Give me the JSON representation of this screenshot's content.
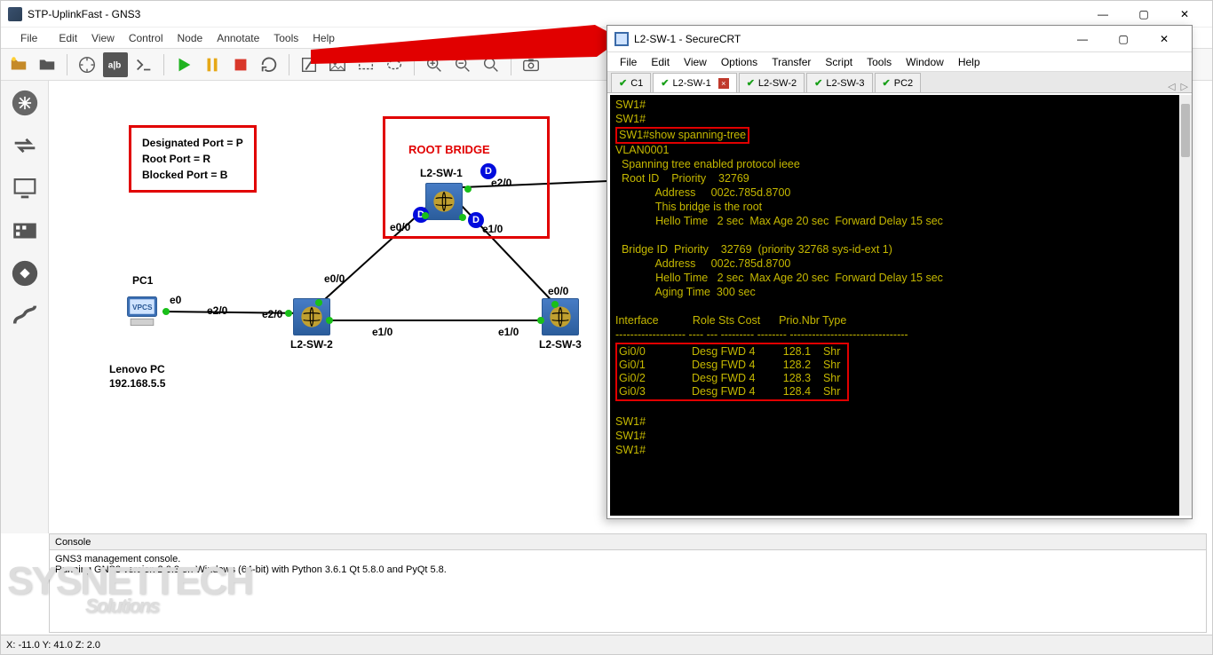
{
  "gns3": {
    "title": "STP-UplinkFast - GNS3",
    "menu": [
      "File",
      "Edit",
      "View",
      "Control",
      "Node",
      "Annotate",
      "Tools",
      "Help"
    ],
    "statusbar": "X: -11.0 Y: 41.0 Z: 2.0",
    "legend": {
      "line1": "Designated Port  = P",
      "line2": "Root Port            = R",
      "line3": "Blocked Port       = B"
    },
    "root_bridge_label": "ROOT BRIDGE",
    "nodes": {
      "sw1": "L2-SW-1",
      "sw2": "L2-SW-2",
      "sw3": "L2-SW-3",
      "pc1": "PC1",
      "pc1_sub1": "Lenovo PC",
      "pc1_sub2": "192.168.5.5",
      "vpcs": "VPCS"
    },
    "ports": {
      "e0": "e0",
      "e20": "e2/0",
      "e00": "e0/0",
      "e10": "e1/0"
    },
    "badge": "D",
    "console_title": "Console",
    "console_lines": [
      "GNS3 management console.",
      "Running GNS3 version 2.0.3 on Windows (64-bit) with Python 3.6.1 Qt 5.8.0 and PyQt 5.8."
    ]
  },
  "securecrt": {
    "title": "L2-SW-1 - SecureCRT",
    "menu": [
      "File",
      "Edit",
      "View",
      "Options",
      "Transfer",
      "Script",
      "Tools",
      "Window",
      "Help"
    ],
    "tabs": [
      {
        "label": "C1",
        "active": false,
        "closable": false
      },
      {
        "label": "L2-SW-1",
        "active": true,
        "closable": true
      },
      {
        "label": "L2-SW-2",
        "active": false,
        "closable": false
      },
      {
        "label": "L2-SW-3",
        "active": false,
        "closable": false
      },
      {
        "label": "PC2",
        "active": false,
        "closable": false
      }
    ],
    "term": {
      "prompts": [
        "SW1#",
        "SW1#"
      ],
      "cmd": "SW1#show spanning-tree",
      "body": "\nVLAN0001\n  Spanning tree enabled protocol ieee\n  Root ID    Priority    32769\n             Address     002c.785d.8700\n             This bridge is the root\n             Hello Time   2 sec  Max Age 20 sec  Forward Delay 15 sec\n\n  Bridge ID  Priority    32769  (priority 32768 sys-id-ext 1)\n             Address     002c.785d.8700\n             Hello Time   2 sec  Max Age 20 sec  Forward Delay 15 sec\n             Aging Time  300 sec\n\nInterface           Role Sts Cost      Prio.Nbr Type\n------------------- ---- --- --------- -------- --------------------------------",
      "table": "Gi0/0               Desg FWD 4         128.1    Shr \nGi0/1               Desg FWD 4         128.2    Shr \nGi0/2               Desg FWD 4         128.3    Shr \nGi0/3               Desg FWD 4         128.4    Shr ",
      "tail": "\n\nSW1#\nSW1#\nSW1#"
    }
  },
  "watermark": {
    "a": "SYSNETTECH",
    "b": "Solutions"
  }
}
